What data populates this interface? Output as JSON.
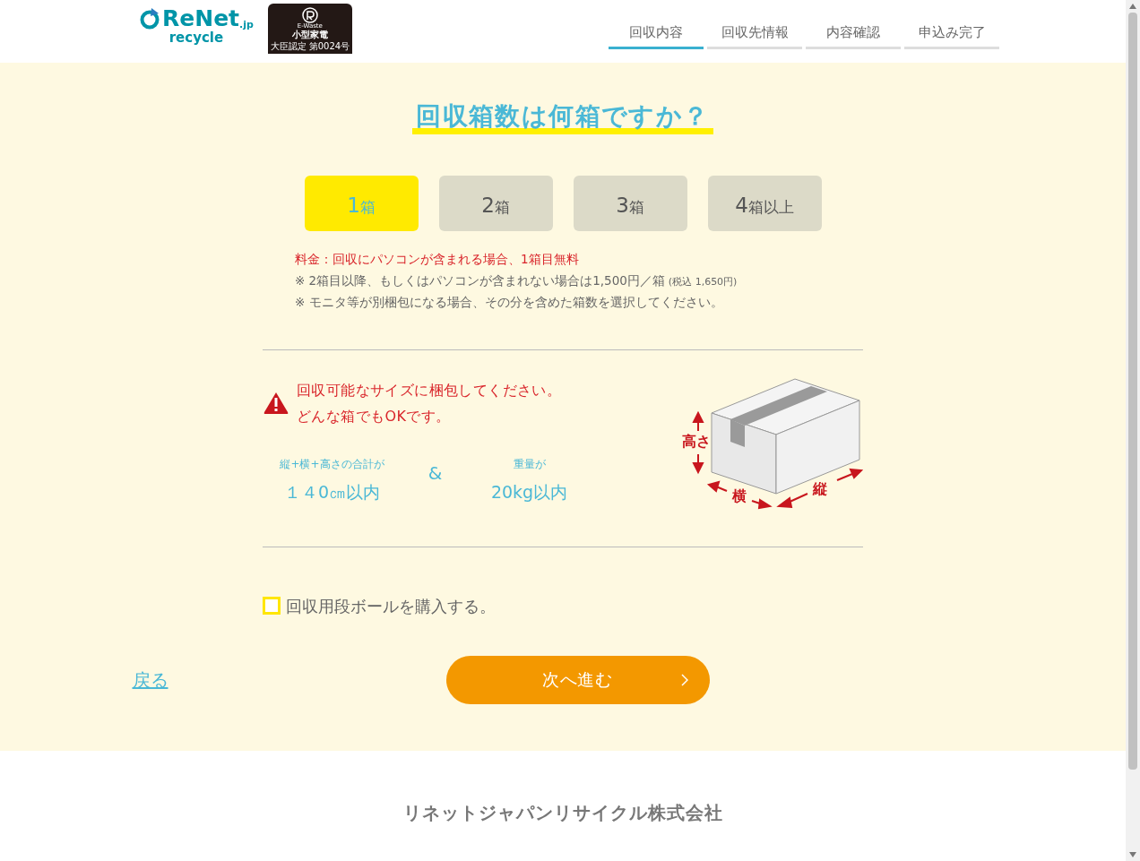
{
  "header": {
    "logo": {
      "name": "ReNet",
      "suffix": ".jp",
      "sub": "recycle"
    },
    "badge": {
      "label": "E-Waste",
      "title": "小型家電",
      "caption": "大臣認定 第0024号"
    },
    "steps": [
      {
        "label": "回収内容",
        "selected": true
      },
      {
        "label": "回収先情報",
        "selected": false
      },
      {
        "label": "内容確認",
        "selected": false
      },
      {
        "label": "申込み完了",
        "selected": false
      }
    ]
  },
  "question": "回収箱数は何箱ですか？",
  "options": [
    {
      "number": "1",
      "unit": "箱",
      "selected": true
    },
    {
      "number": "2",
      "unit": "箱",
      "selected": false
    },
    {
      "number": "3",
      "unit": "箱",
      "selected": false
    },
    {
      "number": "4",
      "unit": "箱以上",
      "selected": false
    }
  ],
  "notes": {
    "fee": "料金：回収にパソコンが含まれる場合、1箱目無料",
    "price": "※ 2箱目以降、もしくはパソコンが含まれない場合は1,500円／箱",
    "tax": "(税込 1,650円)",
    "monitor": "※ モニタ等が別梱包になる場合、その分を含めた箱数を選択してください。"
  },
  "size_notice": {
    "lines": [
      "回収可能なサイズに梱包してください。",
      "どんな箱でもOKです。"
    ],
    "limits": [
      {
        "caption": "縦+横+高さの合計が",
        "value": "１４0㎝以内"
      },
      {
        "caption": "重量が",
        "value": "20kg以内"
      }
    ],
    "joiner": "&",
    "diagram_labels": {
      "height": "高さ",
      "width": "横",
      "depth": "縦"
    }
  },
  "purchase_box": {
    "label": "回収用段ボールを購入する。",
    "checked": false
  },
  "back_link": "戻る",
  "next_button": "次へ進む",
  "footer": {
    "company": "リネットジャパンリサイクル株式会社"
  }
}
